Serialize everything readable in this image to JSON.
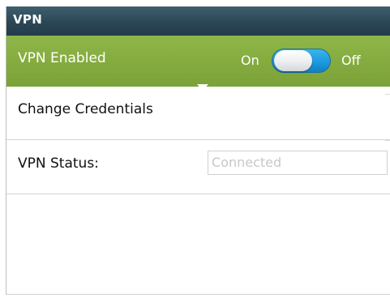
{
  "window": {
    "title": "VPN"
  },
  "vpn_toggle": {
    "label": "VPN Enabled",
    "on_label": "On",
    "off_label": "Off",
    "state": "on"
  },
  "credentials": {
    "label": "Change Credentials"
  },
  "status": {
    "label": "VPN Status:",
    "value": "Connected"
  },
  "colors": {
    "title_bar": "#2b4756",
    "toggle_row": "#86ad40",
    "switch_track": "#1b97dd",
    "field_text": "#c8c8c8"
  }
}
